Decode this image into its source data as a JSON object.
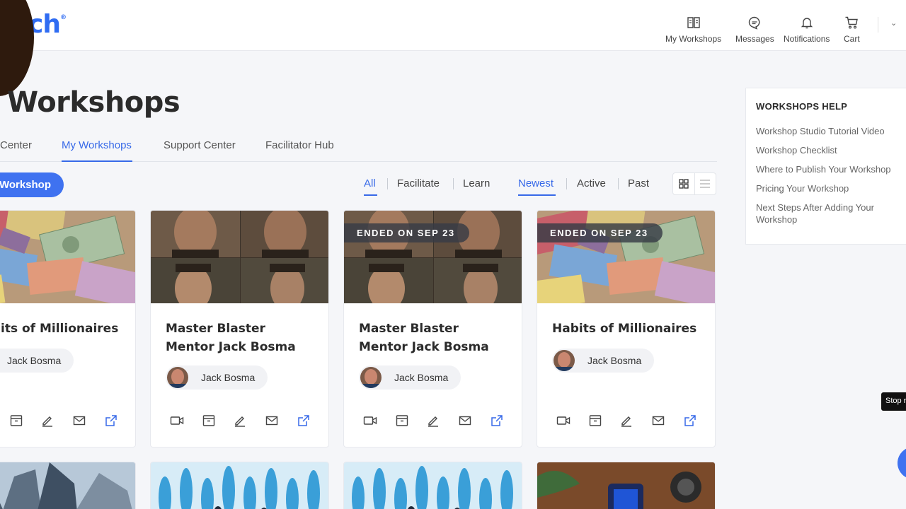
{
  "header": {
    "logo_text": "ch",
    "logo_mark": "®",
    "nav": [
      {
        "label": "My Workshops",
        "icon": "book-icon"
      },
      {
        "label": "Messages",
        "icon": "chat-bubble-icon"
      },
      {
        "label": "Notifications",
        "icon": "bell-icon"
      },
      {
        "label": "Cart",
        "icon": "cart-icon"
      }
    ],
    "caret": "⌄"
  },
  "page": {
    "title": "Workshops"
  },
  "tabs": [
    {
      "label": "Center",
      "active": false
    },
    {
      "label": "My Workshops",
      "active": true
    },
    {
      "label": "Support Center",
      "active": false
    },
    {
      "label": "Facilitator Hub",
      "active": false
    }
  ],
  "create_button": "Workshop",
  "filters": {
    "role": [
      "All",
      "Facilitate",
      "Learn"
    ],
    "time": [
      "Newest",
      "Active",
      "Past"
    ],
    "active_role": "All",
    "active_time": "Newest"
  },
  "cards": [
    {
      "title": "its of Millionaires",
      "author": "Jack Bosma",
      "badge": "",
      "image": "money"
    },
    {
      "title": "Master Blaster Mentor Jack Bosma",
      "author": "Jack Bosma",
      "badge": "",
      "image": "faces"
    },
    {
      "title": "Master Blaster Mentor Jack Bosma",
      "author": "Jack Bosma",
      "badge": "ENDED ON SEP 23",
      "image": "faces"
    },
    {
      "title": "Habits of Millionaires",
      "author": "Jack Bosma",
      "badge": "ENDED ON SEP 23",
      "image": "money"
    }
  ],
  "help": {
    "heading": "WORKSHOPS HELP",
    "links": [
      "Workshop Studio Tutorial Video",
      "Workshop Checklist",
      "Where to Publish Your Workshop",
      "Pricing Your Workshop",
      "Next Steps After Adding Your Workshop"
    ]
  },
  "tooltip": "Stop r",
  "colors": {
    "accent": "#3769e8",
    "button": "#3f72f0"
  }
}
